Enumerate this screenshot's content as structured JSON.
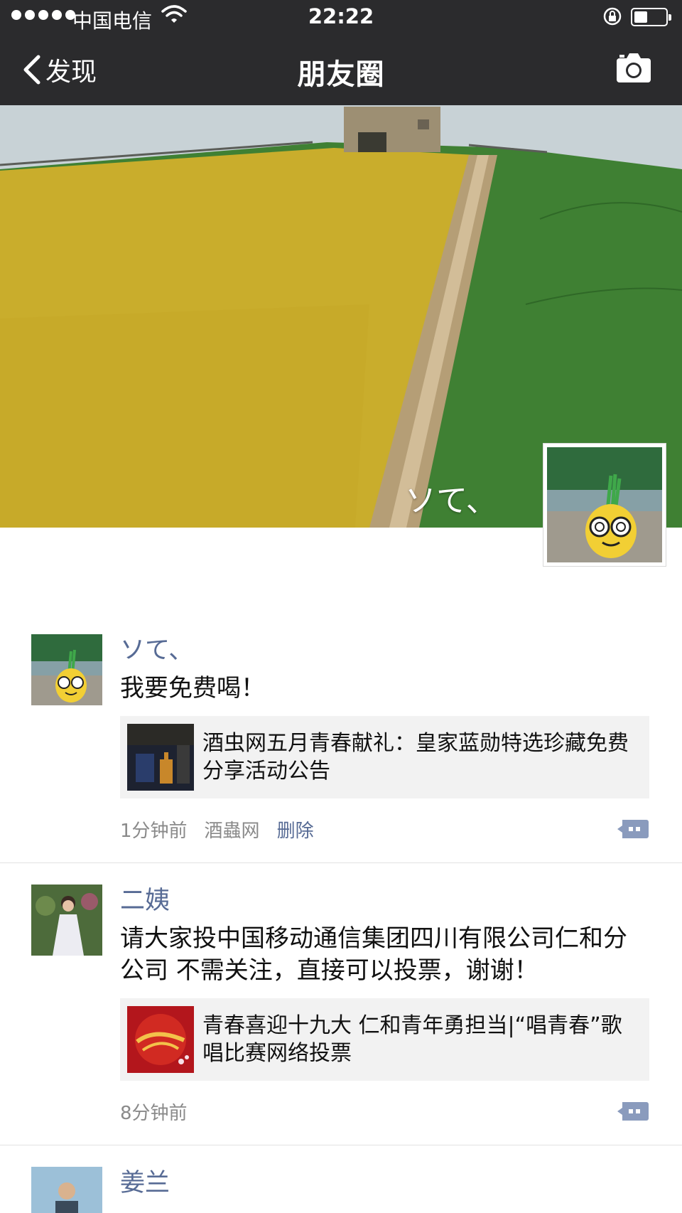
{
  "status": {
    "carrier": "中国电信",
    "time": "22:22",
    "battery_level": 0.42
  },
  "nav": {
    "back_label": "发现",
    "title": "朋友圈"
  },
  "cover": {
    "user_name": "ソて、"
  },
  "posts": [
    {
      "name": "ソて、",
      "text": "我要免费喝！",
      "link_title": "酒虫网五月青春献礼：皇家蓝勋特选珍藏免费分享活动公告",
      "time": "1分钟前",
      "source": "酒蟲网",
      "delete_label": "删除"
    },
    {
      "name": "二姨",
      "text": "请大家投中国移动通信集团四川有限公司仁和分公司 不需关注，直接可以投票，谢谢！",
      "link_title": "青春喜迎十九大 仁和青年勇担当|“唱青春”歌唱比赛网络投票",
      "time": "8分钟前"
    },
    {
      "name": "姜兰"
    }
  ],
  "colors": {
    "topbar": "#2b2b2d",
    "link_name": "#576b95",
    "meta_gray": "#8a8a8a"
  }
}
